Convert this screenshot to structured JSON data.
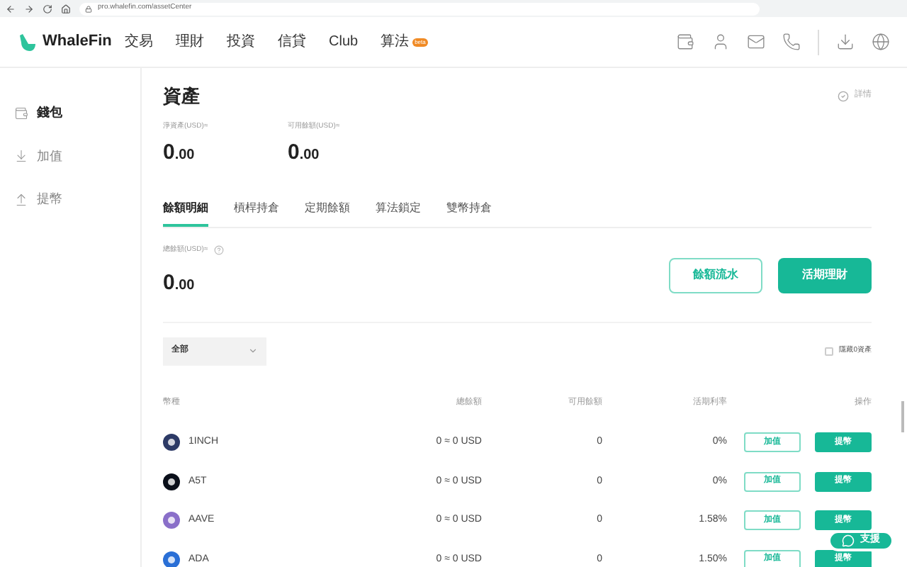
{
  "browser": {
    "url": "pro.whalefin.com/assetCenter"
  },
  "header": {
    "logo": "WhaleFin",
    "nav": [
      {
        "label": "交易"
      },
      {
        "label": "理財"
      },
      {
        "label": "投資"
      },
      {
        "label": "信貸"
      },
      {
        "label": "Club"
      },
      {
        "label": "算法",
        "badge": "beta"
      }
    ]
  },
  "sidebar": {
    "items": [
      {
        "label": "錢包",
        "selected": true
      },
      {
        "label": "加值",
        "selected": false
      },
      {
        "label": "提幣",
        "selected": false
      }
    ]
  },
  "page": {
    "title": "資產",
    "detail_link": "詳情",
    "summary": [
      {
        "label": "淨資產(USD)≈",
        "value": "0",
        "decimals": ".00"
      },
      {
        "label": "可用餘額(USD)≈",
        "value": "0",
        "decimals": ".00"
      }
    ],
    "tabs": [
      {
        "label": "餘額明細",
        "selected": true
      },
      {
        "label": "槓桿持倉",
        "selected": false
      },
      {
        "label": "定期餘額",
        "selected": false
      },
      {
        "label": "算法鎖定",
        "selected": false
      },
      {
        "label": "雙幣持倉",
        "selected": false
      }
    ],
    "balance": {
      "label": "總餘額(USD)≈",
      "value": "0",
      "decimals": ".00"
    },
    "buttons": [
      {
        "label": "餘額流水",
        "kind": "outline"
      },
      {
        "label": "活期理財",
        "kind": "filled"
      }
    ],
    "filter": {
      "value": "全部"
    },
    "hide_zero": {
      "label": "隱藏0資產",
      "checked": false
    }
  },
  "table": {
    "columns": [
      "幣種",
      "總餘額",
      "可用餘額",
      "活期利率",
      "操作"
    ],
    "rows": [
      {
        "coin": "1INCH",
        "color": "#2d3a66",
        "total": "0 ≈ 0 USD",
        "available": "0",
        "rate": "0%",
        "actions": [
          "加值",
          "提幣"
        ]
      },
      {
        "coin": "A5T",
        "color": "#0a0f1a",
        "total": "0 ≈ 0 USD",
        "available": "0",
        "rate": "0%",
        "actions": [
          "加值",
          "提幣"
        ]
      },
      {
        "coin": "AAVE",
        "color": "#8a6fc9",
        "total": "0 ≈ 0 USD",
        "available": "0",
        "rate": "1.58%",
        "actions": [
          "加值",
          "提幣"
        ]
      },
      {
        "coin": "ADA",
        "color": "#2a6fd6",
        "total": "0 ≈ 0 USD",
        "available": "0",
        "rate": "1.50%",
        "actions": [
          "加值",
          "提幣"
        ]
      }
    ]
  },
  "support": {
    "label": "支援"
  }
}
